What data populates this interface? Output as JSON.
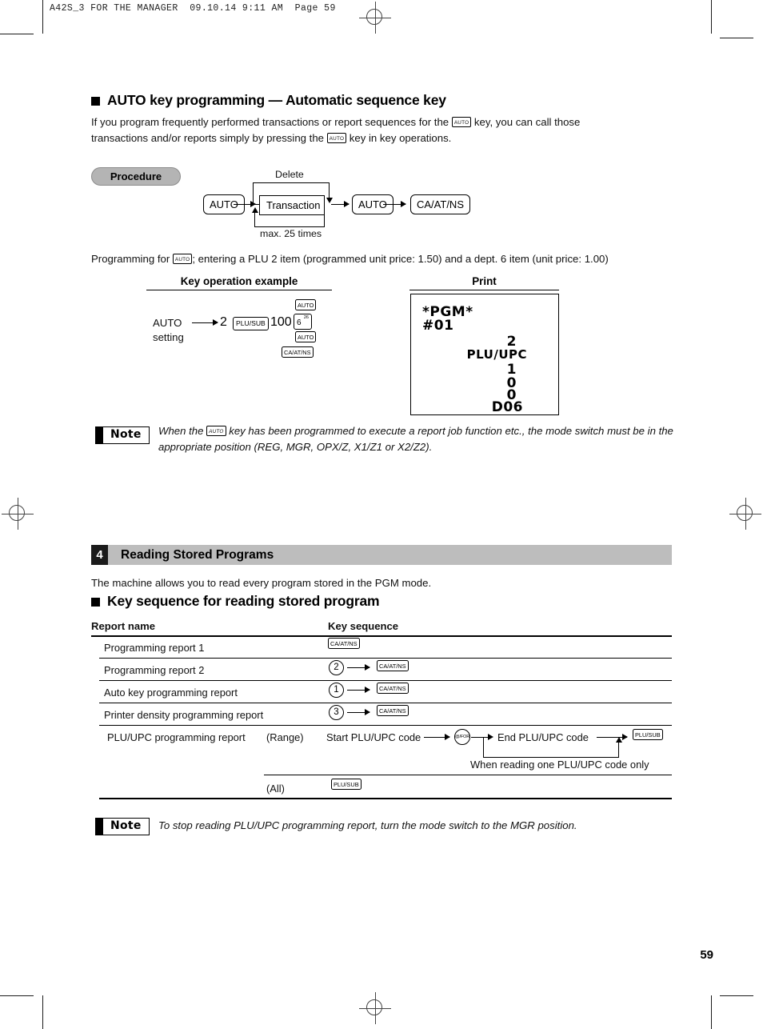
{
  "print_slug": "A42S_3 FOR THE MANAGER  09.10.14 9:11 AM  Page 59",
  "page_number": "59",
  "section_auto": {
    "heading": "AUTO key programming — Automatic sequence key",
    "intro_1a": "If you program frequently performed transactions or report sequences for the",
    "intro_key": "AUTO",
    "intro_1b": "key, you can call those",
    "intro_2a": "transactions and/or reports simply by pressing the",
    "intro_2b": "key in key operations.",
    "procedure_label": "Procedure",
    "diagram": {
      "delete_label": "Delete",
      "key_auto_1": "AUTO",
      "transaction_box": "Transaction",
      "max_label": "max. 25 times",
      "key_auto_2": "AUTO",
      "key_ca": "CA/AT/NS"
    },
    "programming_line_a": "Programming for",
    "programming_key": "AUTO",
    "programming_line_b": "; entering a PLU 2 item (programmed unit price: 1.50) and a dept. 6 item (unit price: 1.00)",
    "col_key_operation": "Key operation example",
    "col_print": "Print",
    "example": {
      "label_line1": "AUTO",
      "label_line2": "setting",
      "value_2": "2",
      "key_plusub": "PLU/SUB",
      "value_100": "100",
      "key_auto_top": "AUTO",
      "key_dept_digit": "6",
      "key_dept_sup": "26",
      "key_auto_bottom": "AUTO",
      "key_ca": "CA/AT/NS"
    },
    "receipt": {
      "line_pgm": "*PGM*",
      "line_no": "#01",
      "right_lines": [
        "2",
        "PLU/UPC",
        "1",
        "0",
        "0",
        "D06"
      ]
    },
    "note": {
      "label": "Note",
      "text_a": "When the",
      "text_key": "AUTO",
      "text_b": "key has been programmed to execute a report job function etc., the mode switch",
      "text_c": "must be in the appropriate position (REG, MGR, OPX/Z, X1/Z1 or X2/Z2)."
    }
  },
  "section_reading": {
    "number": "4",
    "title": "Reading Stored Programs",
    "intro": "The machine allows you to read every program stored in the PGM mode.",
    "subheading": "Key sequence for reading stored program",
    "table": {
      "header_report": "Report name",
      "header_sequence": "Key sequence",
      "rows": [
        {
          "name": "Programming report 1",
          "num": "",
          "key": "CA/AT/NS"
        },
        {
          "name": "Programming report 2",
          "num": "2",
          "key": "CA/AT/NS"
        },
        {
          "name": "Auto key programming report",
          "num": "1",
          "key": "CA/AT/NS"
        },
        {
          "name": "Printer density programming report",
          "num": "3",
          "key": "CA/AT/NS"
        }
      ],
      "plu_row": {
        "name": "PLU/UPC programming report",
        "range_label": "(Range)",
        "start_text": "Start PLU/UPC code",
        "at_for_key": "@/FOR",
        "end_text": "End PLU/UPC code",
        "plusub_key": "PLU/SUB",
        "footnote": "When reading one PLU/UPC code only",
        "all_label": "(All)",
        "all_key": "PLU/SUB"
      }
    },
    "note": {
      "label": "Note",
      "text": "To stop reading PLU/UPC programming report, turn the mode switch to the MGR position."
    }
  }
}
